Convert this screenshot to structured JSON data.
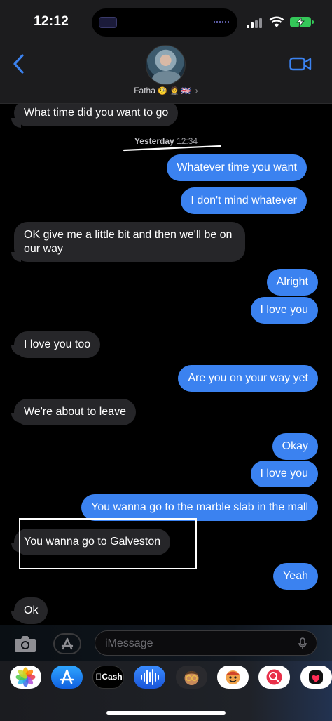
{
  "status_bar": {
    "time": "12:12"
  },
  "header": {
    "contact_name": "Fatha",
    "contact_emojis": "🧐 🤵 🇬🇧",
    "back_icon": "chevron-left-icon",
    "video_icon": "video-camera-icon",
    "accent_color": "#3b82f0"
  },
  "messages": [
    {
      "direction": "in",
      "text": "What time did you want to go"
    },
    {
      "direction": "timestamp",
      "day": "Yesterday",
      "time": "12:34"
    },
    {
      "direction": "out",
      "text": "Whatever time you want"
    },
    {
      "direction": "out",
      "text": "I don't mind whatever"
    },
    {
      "direction": "in",
      "text": "OK give me a little bit and then we'll be on",
      "text2": "our way"
    },
    {
      "direction": "out",
      "text": "Alright"
    },
    {
      "direction": "out",
      "text": "I love you"
    },
    {
      "direction": "in",
      "text": "I love you too"
    },
    {
      "direction": "out",
      "text": "Are you on your way yet"
    },
    {
      "direction": "in",
      "text": "We're about to leave"
    },
    {
      "direction": "out",
      "text": "Okay"
    },
    {
      "direction": "out",
      "text": "I love you"
    },
    {
      "direction": "out",
      "text": "You wanna go to the marble slab in the mall"
    },
    {
      "direction": "in",
      "text": "You wanna go to Galveston",
      "highlighted": true
    },
    {
      "direction": "out",
      "text": "Yeah"
    },
    {
      "direction": "in",
      "text": "Ok"
    }
  ],
  "input": {
    "placeholder": "iMessage",
    "camera_icon": "camera-icon",
    "apps_icon": "app-store-icon",
    "mic_icon": "microphone-icon"
  },
  "app_tray": {
    "cash_label": "Cash",
    "apps": [
      "photos-icon",
      "app-store-icon",
      "apple-cash-icon",
      "audio-message-icon",
      "memoji-icon",
      "memoji-stickers-icon",
      "image-search-icon",
      "digital-touch-icon"
    ]
  },
  "colors": {
    "incoming_bubble": "#262629",
    "outgoing_bubble": "#3b82f0",
    "battery": "#34c759"
  }
}
